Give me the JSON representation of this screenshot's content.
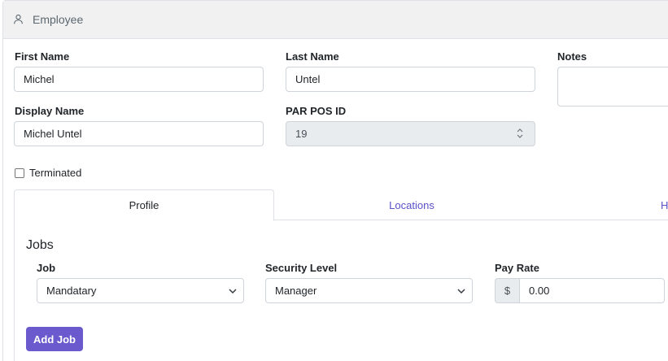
{
  "header": {
    "title": "Employee",
    "icon": "person-icon"
  },
  "form": {
    "first_name": {
      "label": "First Name",
      "value": "Michel"
    },
    "last_name": {
      "label": "Last Name",
      "value": "Untel"
    },
    "notes": {
      "label": "Notes",
      "value": ""
    },
    "display_name": {
      "label": "Display Name",
      "value": "Michel Untel"
    },
    "par_pos_id": {
      "label": "PAR POS ID",
      "value": "19"
    },
    "terminated": {
      "label": "Terminated",
      "checked": false
    }
  },
  "tabs": [
    {
      "label": "Profile",
      "active": true
    },
    {
      "label": "Locations",
      "active": false
    },
    {
      "label": "H",
      "active": false
    }
  ],
  "jobs": {
    "title": "Jobs",
    "job": {
      "label": "Job",
      "value": "Mandatary"
    },
    "security_level": {
      "label": "Security Level",
      "value": "Manager"
    },
    "pay_rate": {
      "label": "Pay Rate",
      "prefix": "$",
      "value": "0.00"
    },
    "add_button": "Add Job"
  },
  "colors": {
    "accent": "#6a5acd",
    "link": "#5a50c9",
    "header_bg": "#f1f1f1"
  }
}
